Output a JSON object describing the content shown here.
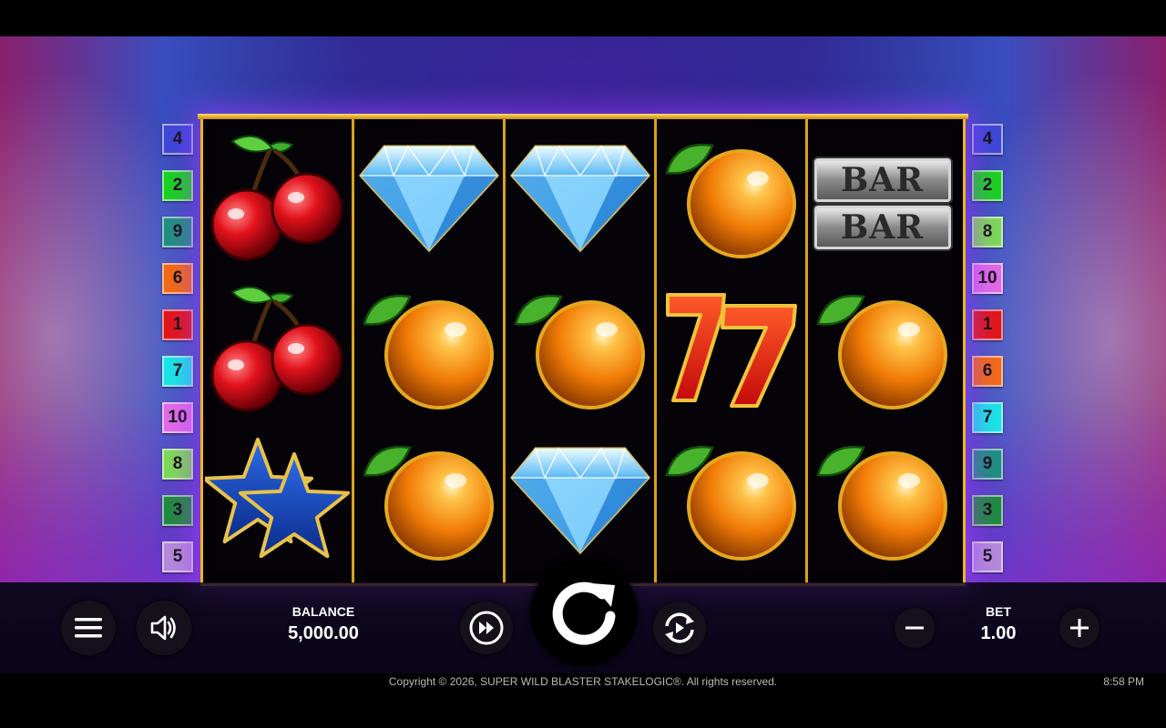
{
  "reels": [
    [
      "cherry",
      "cherry",
      "star"
    ],
    [
      "diamond",
      "orange",
      "orange"
    ],
    [
      "diamond",
      "orange",
      "diamond"
    ],
    [
      "orange",
      "seven",
      "orange"
    ],
    [
      "bar",
      "orange",
      "orange"
    ]
  ],
  "bar_label": "BAR",
  "paylines_left": [
    {
      "num": "4",
      "color": "#3d47d6"
    },
    {
      "num": "2",
      "color": "#19d21f"
    },
    {
      "num": "9",
      "color": "#1f8f7f"
    },
    {
      "num": "6",
      "color": "#f26b12"
    },
    {
      "num": "1",
      "color": "#e11616"
    },
    {
      "num": "7",
      "color": "#18e6e6"
    },
    {
      "num": "10",
      "color": "#e06be6"
    },
    {
      "num": "8",
      "color": "#7ed957"
    },
    {
      "num": "3",
      "color": "#1f8a3e"
    },
    {
      "num": "5",
      "color": "#b58ad9"
    }
  ],
  "paylines_right": [
    {
      "num": "4",
      "color": "#3d47d6"
    },
    {
      "num": "2",
      "color": "#19d21f"
    },
    {
      "num": "8",
      "color": "#7ed957"
    },
    {
      "num": "10",
      "color": "#e06be6"
    },
    {
      "num": "1",
      "color": "#e11616"
    },
    {
      "num": "6",
      "color": "#f26b12"
    },
    {
      "num": "7",
      "color": "#18e6e6"
    },
    {
      "num": "9",
      "color": "#1f8f7f"
    },
    {
      "num": "3",
      "color": "#1f8a3e"
    },
    {
      "num": "5",
      "color": "#b58ad9"
    }
  ],
  "controls": {
    "balance_label": "BALANCE",
    "balance_value": "5,000.00",
    "bet_label": "BET",
    "bet_value": "1.00",
    "icons": {
      "menu": "menu-icon",
      "sound": "speaker-icon",
      "turbo": "fast-forward-icon",
      "spin": "spin-arrow-icon",
      "autoplay": "autoplay-icon",
      "minus": "minus-icon",
      "plus": "plus-icon"
    }
  },
  "footer": {
    "copyright": "Copyright © 2026, SUPER WILD BLASTER STAKELOGIC®. All rights reserved.",
    "time": "8:58 PM"
  },
  "colors": {
    "frame_gold": "#f2b51c",
    "glow": "#a03cff"
  }
}
